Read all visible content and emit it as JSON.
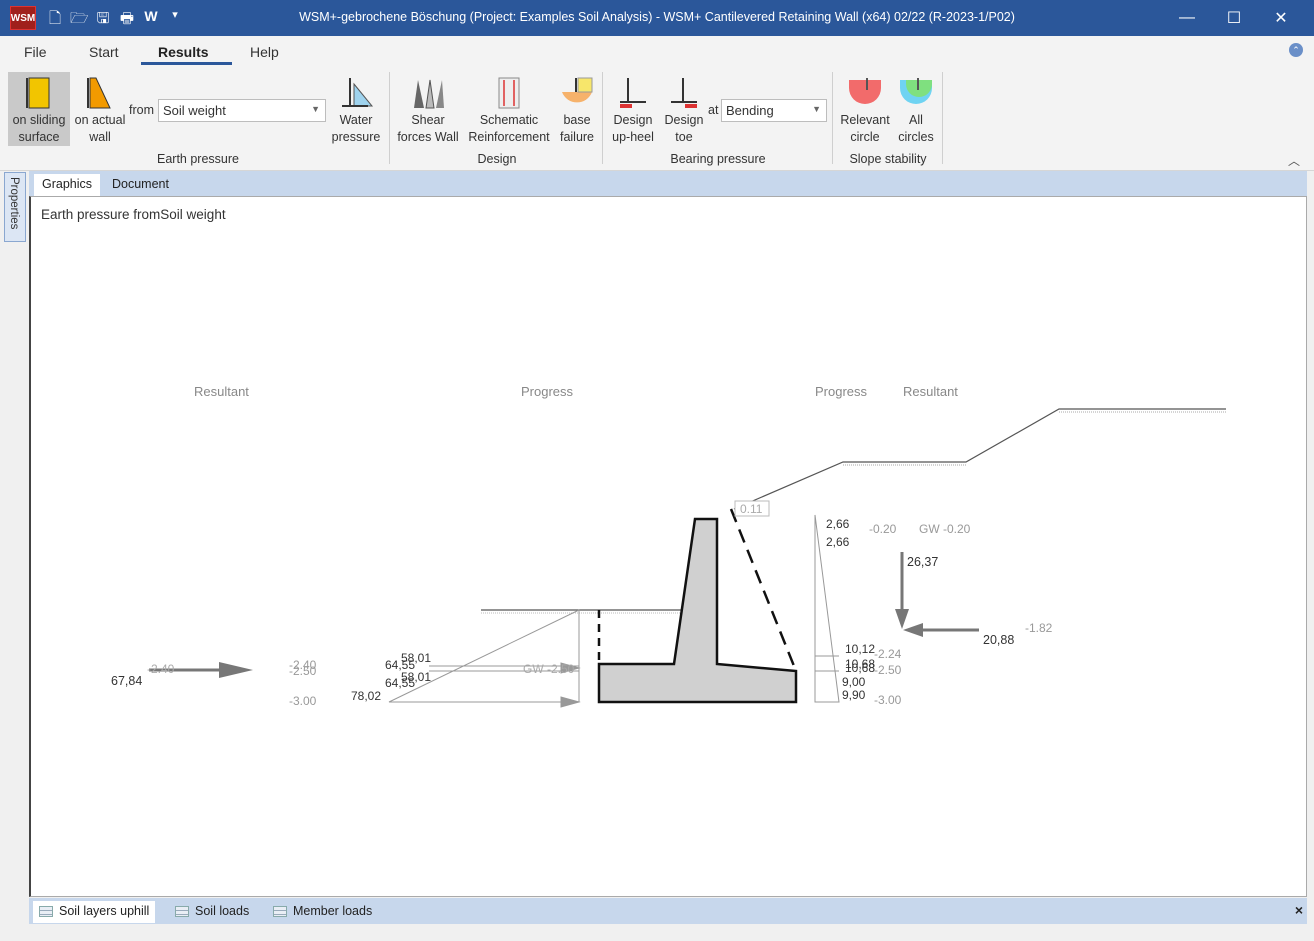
{
  "window": {
    "logo": "WSM",
    "title": "WSM+-gebrochene Böschung (Project: Examples Soil Analysis) - WSM+ Cantilevered Retaining Wall (x64) 02/22 (R-2023-1/P02)",
    "qat_w": "W"
  },
  "menu": {
    "file": "File",
    "start": "Start",
    "results": "Results",
    "help": "Help"
  },
  "ribbon": {
    "earth_pressure": {
      "sliding_l1": "on sliding",
      "sliding_l2": "surface",
      "actual_l1": "on actual",
      "actual_l2": "wall",
      "from_label": "from",
      "from_value": "Soil weight",
      "water_l1": "Water",
      "water_l2": "pressure",
      "group": "Earth pressure"
    },
    "design": {
      "shear_l1": "Shear",
      "shear_l2": "forces Wall",
      "schem_l1": "Schematic",
      "schem_l2": "Reinforcement",
      "base_l1": "base",
      "base_l2": "failure",
      "group": "Design"
    },
    "bearing": {
      "upheel_l1": "Design",
      "upheel_l2": "up-heel",
      "toe_l1": "Design",
      "toe_l2": "toe",
      "at_label": "at",
      "at_value": "Bending",
      "group": "Bearing pressure"
    },
    "slope": {
      "relevant_l1": "Relevant",
      "relevant_l2": "circle",
      "all_l1": "All",
      "all_l2": "circles",
      "group": "Slope stability"
    }
  },
  "side_tab": "Properties",
  "doc_tabs": [
    "Graphics",
    "Document"
  ],
  "canvas": {
    "title": "Earth pressure fromSoil weight",
    "headers": {
      "resultant_left": "Resultant",
      "progress_left": "Progress",
      "progress_right": "Progress",
      "resultant_right": "Resultant"
    },
    "left": {
      "resultant_value": "67,84",
      "resultant_level": "-2.40",
      "lvl_a": "-2.40",
      "lvl_b": "-2.50",
      "lvl_c": "-3.00",
      "v1": "58,01",
      "v2": "64,55",
      "v3": "58,01",
      "v4": "64,55",
      "v5": "78,02",
      "gw": "GW -2.50"
    },
    "right": {
      "top_level": "0.11",
      "v_top1": "2,66",
      "v_top2": "2,66",
      "lvl_top": "-0.20",
      "gw": "GW -0.20",
      "vertical": "26,37",
      "horizontal": "20,88",
      "horizontal_level": "-1.82",
      "v_bot1": "10,12",
      "v_bot2": "10,68",
      "v_bot3": "10,68",
      "v_bot4": "9,00",
      "v_bot5": "9,90",
      "lvl_b1": "-2.24",
      "lvl_b2": "-2.50",
      "lvl_b3": "-3.00"
    }
  },
  "bottom_tabs": [
    "Soil layers uphill",
    "Soil loads",
    "Member loads"
  ],
  "close": "×",
  "colors": {
    "titlebar": "#2b579a",
    "accent": "#2b579a",
    "tab_strip": "#c7d7ec"
  }
}
